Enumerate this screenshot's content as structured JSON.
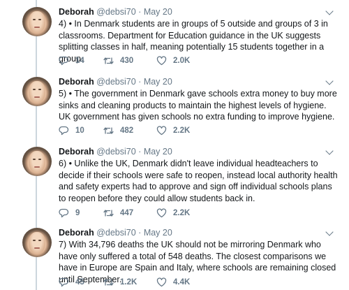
{
  "tweets": [
    {
      "name": "Deborah",
      "handle": "@debsi70",
      "sep": "·",
      "date": "May 20",
      "text": "4) • In Denmark students are in groups of 5 outside and groups of 3 in classrooms. Department for Education guidance in the UK suggests splitting classes in half, meaning potentially 15 students together in a group.",
      "replies": "14",
      "retweets": "430",
      "likes": "2.0K"
    },
    {
      "name": "Deborah",
      "handle": "@debsi70",
      "sep": "·",
      "date": "May 20",
      "text": "5) • The government in Denmark gave schools extra money to buy more sinks and cleaning products to maintain the highest levels of hygiene. UK government has given schools no extra funding to improve hygiene.",
      "replies": "10",
      "retweets": "482",
      "likes": "2.2K"
    },
    {
      "name": "Deborah",
      "handle": "@debsi70",
      "sep": "·",
      "date": "May 20",
      "text": "6) • Unlike the UK, Denmark didn't leave individual headteachers to decide if their schools were safe to reopen, instead local authority health and safety experts had to approve and sign off individual schools plans to reopen before they could allow students back in.",
      "replies": "9",
      "retweets": "447",
      "likes": "2.2K"
    },
    {
      "name": "Deborah",
      "handle": "@debsi70",
      "sep": "·",
      "date": "May 20",
      "text": "7) With 34,796 deaths the UK should not be mirroring Denmark who have only suffered a total of 548 deaths. The closest comparisons we have in Europe are Spain and Italy, where schools are remaining closed until September.",
      "replies": "45",
      "retweets": "1.2K",
      "likes": "4.4K"
    }
  ],
  "icons": {
    "reply": "reply-icon",
    "retweet": "retweet-icon",
    "like": "heart-icon",
    "menu": "chevron-down-icon"
  },
  "colors": {
    "text": "#14171a",
    "muted": "#657786",
    "thread_line": "#ccd6dd"
  }
}
